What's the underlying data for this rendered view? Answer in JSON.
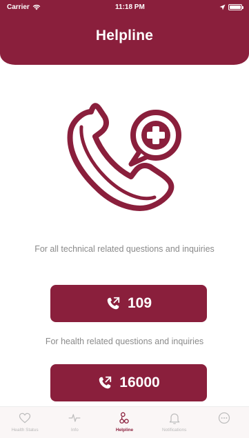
{
  "status_bar": {
    "carrier": "Carrier",
    "time": "11:18 PM"
  },
  "header": {
    "title": "Helpline"
  },
  "hero": {
    "icon": "phone-plus-icon"
  },
  "sections": [
    {
      "caption": "For all technical related questions and inquiries",
      "number": "109"
    },
    {
      "caption": "For health related questions and inquiries",
      "number": "16000"
    }
  ],
  "tabbar": {
    "tabs": [
      {
        "label": "Health Status",
        "icon": "heart-icon"
      },
      {
        "label": "Info",
        "icon": "pulse-icon"
      },
      {
        "label": "Helpline",
        "icon": "helpline-icon"
      },
      {
        "label": "Notifications",
        "icon": "bell-icon"
      },
      {
        "label": "",
        "icon": "more-icon"
      }
    ],
    "active_index": 2
  },
  "colors": {
    "brand": "#8a1f3c",
    "muted_text": "#8a8a8a",
    "tab_inactive": "#b8b8b8"
  }
}
